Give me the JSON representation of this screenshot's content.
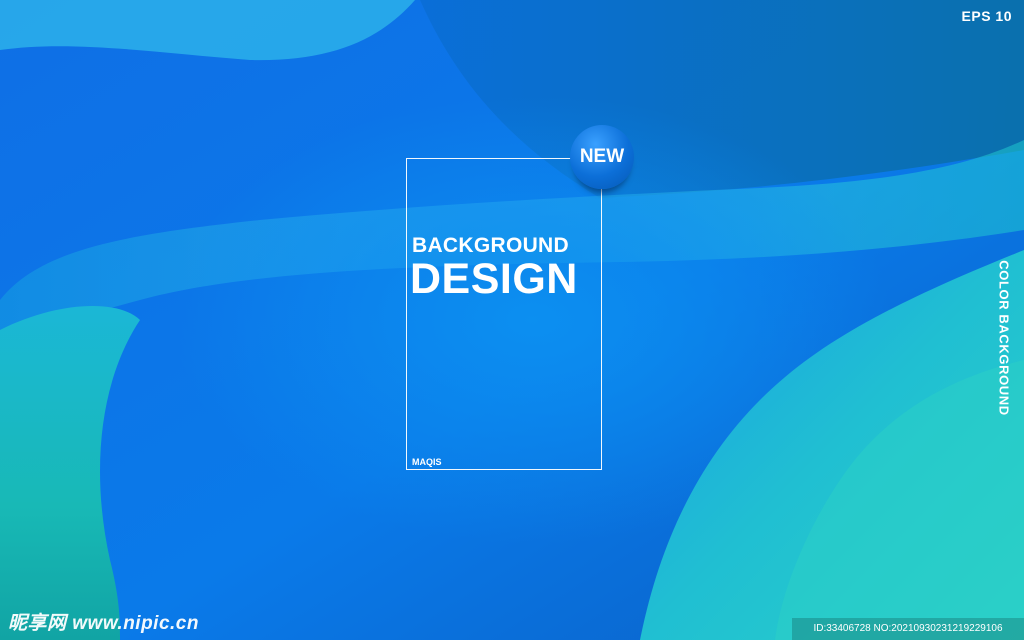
{
  "corner_label": "EPS 10",
  "badge": {
    "label": "NEW"
  },
  "headline": {
    "line1": "BACKGROUND",
    "line2": "DESIGN"
  },
  "frame_caption": "MAQIS",
  "side_text": "COLOR BACKGROUND",
  "watermark": "昵享网 www.nipic.cn",
  "stock_id": "ID:33406728 NO:20210930231219229106",
  "colors": {
    "base_blue": "#0a74e6",
    "deep_blue": "#0558b5",
    "cyan": "#23c6c9",
    "teal": "#1fb3b8",
    "text": "#ffffff"
  }
}
